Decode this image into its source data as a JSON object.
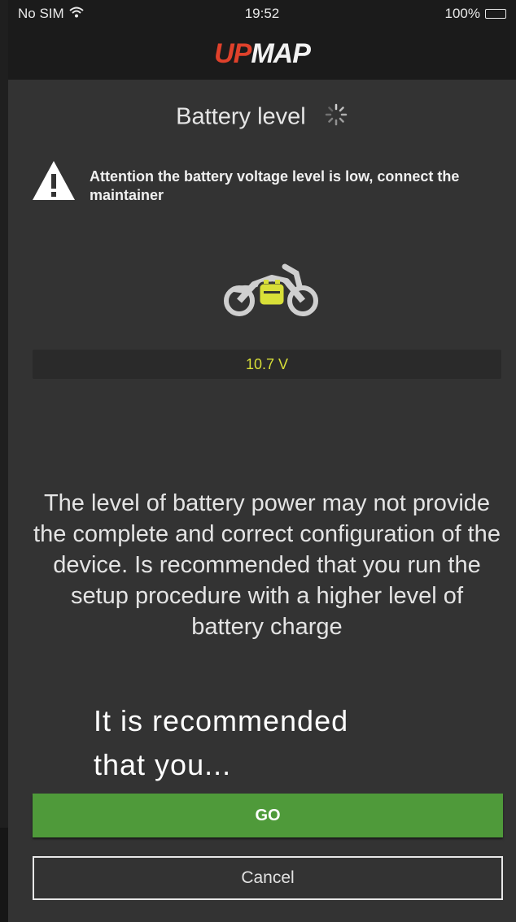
{
  "status_bar": {
    "carrier": "No SIM",
    "time": "19:52",
    "battery_percent": "100%",
    "icons": [
      "wifi-icon",
      "battery-icon"
    ]
  },
  "header": {
    "logo_part_1": "UP",
    "logo_part_2": "MAP"
  },
  "page": {
    "title": "Battery level"
  },
  "warning": {
    "icon": "warning-triangle-icon",
    "text": "Attention the battery voltage level is low, connect the maintainer"
  },
  "battery": {
    "icon": "motorcycle-battery-icon",
    "voltage": "10.7 V"
  },
  "message": "The level of battery power may not provide the complete and correct configuration of the device. Is recommended that you run the setup procedure with a higher level of battery charge",
  "overlay": {
    "line1": "It is recommended",
    "line2": "that you..."
  },
  "buttons": {
    "go_label": "GO",
    "cancel_label": "Cancel"
  },
  "colors": {
    "background": "#333333",
    "header": "#1b1b1b",
    "go_button": "#4f9a3a",
    "voltage_text": "#d8df38",
    "logo_accent": "#e0412b"
  }
}
